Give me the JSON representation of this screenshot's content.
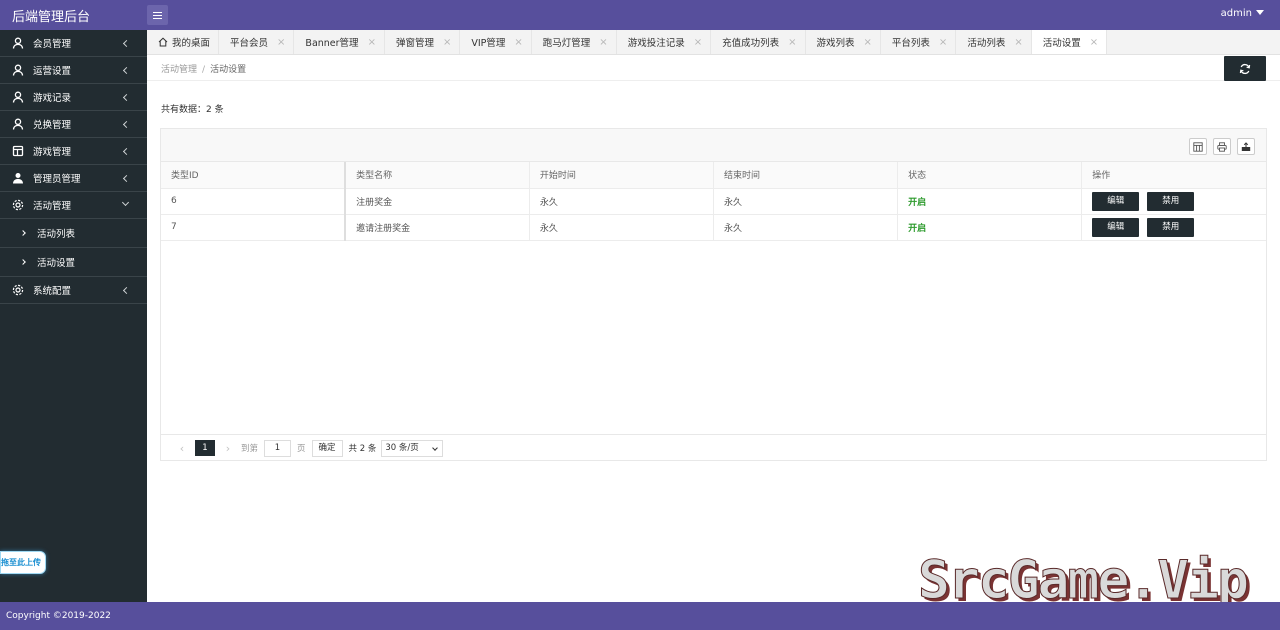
{
  "header": {
    "brand": "后端管理后台",
    "user": "admin"
  },
  "sidebar": {
    "items": [
      {
        "label": "会员管理",
        "icon": "user-icon"
      },
      {
        "label": "运营设置",
        "icon": "user-icon"
      },
      {
        "label": "游戏记录",
        "icon": "user-icon"
      },
      {
        "label": "兑换管理",
        "icon": "user-icon"
      },
      {
        "label": "游戏管理",
        "icon": "list-icon"
      },
      {
        "label": "管理员管理",
        "icon": "user-group-icon"
      },
      {
        "label": "活动管理",
        "icon": "gear-icon",
        "expanded": true
      },
      {
        "label": "系统配置",
        "icon": "gear-icon"
      }
    ],
    "subitems": [
      {
        "label": "活动列表"
      },
      {
        "label": "活动设置"
      }
    ],
    "upload_hint": "拖至此上传"
  },
  "tabs": [
    {
      "label": "我的桌面"
    },
    {
      "label": "平台会员"
    },
    {
      "label": "Banner管理"
    },
    {
      "label": "弹窗管理"
    },
    {
      "label": "VIP管理"
    },
    {
      "label": "跑马灯管理"
    },
    {
      "label": "游戏投注记录"
    },
    {
      "label": "充值成功列表"
    },
    {
      "label": "游戏列表"
    },
    {
      "label": "平台列表"
    },
    {
      "label": "活动列表"
    },
    {
      "label": "活动设置",
      "active": true
    }
  ],
  "breadcrumb": {
    "parent": "活动管理",
    "current": "活动设置"
  },
  "summary": {
    "total_text": "共有数据：2 条"
  },
  "table": {
    "columns": [
      "类型ID",
      "类型名称",
      "开始时间",
      "结束时间",
      "状态",
      "操作"
    ],
    "rows": [
      {
        "id": "6",
        "name": "注册奖金",
        "start": "永久",
        "end": "永久",
        "status": "开启"
      },
      {
        "id": "7",
        "name": "邀请注册奖金",
        "start": "永久",
        "end": "永久",
        "status": "开启"
      }
    ],
    "edit_label": "编辑",
    "disable_label": "禁用"
  },
  "pager": {
    "current": "1",
    "goto_label": "到第",
    "page_input": "1",
    "page_unit": "页",
    "confirm_label": "确定",
    "total_label": "共 2 条",
    "page_size": "30 条/页"
  },
  "footer": {
    "copyright": "Copyright ©2019-2022"
  },
  "watermark": "SrcGame.Vip",
  "colors": {
    "header": "#574f9c",
    "sidebar": "#222c31",
    "button_dark": "#222c31",
    "status_on": "#2c9a2c"
  }
}
